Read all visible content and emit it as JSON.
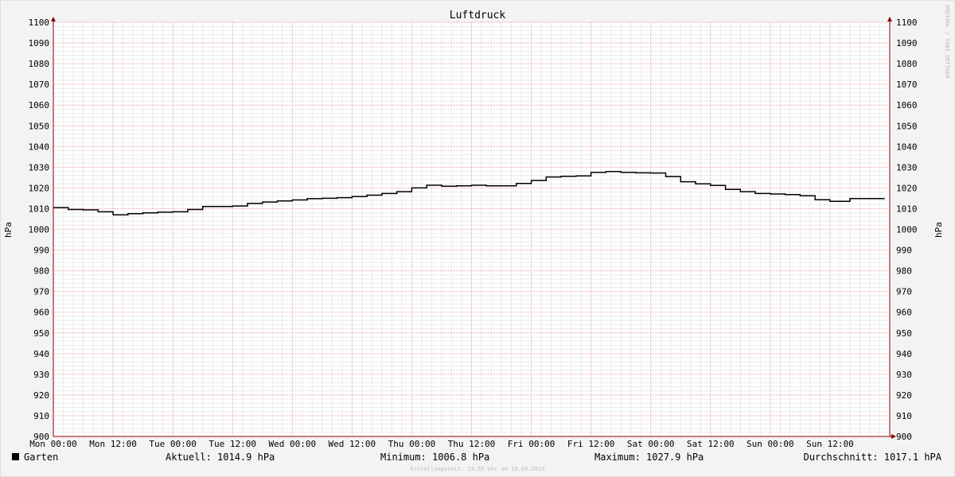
{
  "chart_data": {
    "type": "line",
    "title": "Luftdruck",
    "ylabel": "hPa",
    "ylim": [
      900,
      1100
    ],
    "y_major_step": 10,
    "y_minor_step": 2,
    "xlim": [
      "Mon 00:00",
      "Mon 00:00 (+7d)"
    ],
    "x_tick_labels": [
      "Mon 00:00",
      "Mon 12:00",
      "Tue 00:00",
      "Tue 12:00",
      "Wed 00:00",
      "Wed 12:00",
      "Thu 00:00",
      "Thu 12:00",
      "Fri 00:00",
      "Fri 12:00",
      "Sat 00:00",
      "Sat 12:00",
      "Sun 00:00",
      "Sun 12:00"
    ],
    "x_major_step_hours": 12,
    "x_minor_step_hours": 2,
    "grid": true,
    "line_style": "step",
    "series": [
      {
        "name": "Garten",
        "color": "#000000",
        "x_hours": [
          0,
          3,
          6,
          9,
          12,
          15,
          18,
          21,
          24,
          27,
          30,
          33,
          36,
          39,
          42,
          45,
          48,
          51,
          54,
          57,
          60,
          63,
          66,
          69,
          72,
          75,
          78,
          81,
          84,
          87,
          90,
          93,
          96,
          99,
          102,
          105,
          108,
          111,
          114,
          117,
          120,
          123,
          126,
          129,
          132,
          135,
          138,
          141,
          144,
          147,
          150,
          153,
          156,
          160,
          164,
          167
        ],
        "values": [
          1010.5,
          1009.6,
          1009.4,
          1008.5,
          1007.0,
          1007.6,
          1008.0,
          1008.3,
          1008.5,
          1009.6,
          1011.0,
          1011.0,
          1011.3,
          1012.5,
          1013.2,
          1013.7,
          1014.2,
          1014.8,
          1015.0,
          1015.3,
          1015.8,
          1016.5,
          1017.3,
          1018.2,
          1020.0,
          1021.3,
          1020.8,
          1021.0,
          1021.3,
          1021.0,
          1021.0,
          1022.2,
          1023.6,
          1025.3,
          1025.6,
          1025.8,
          1027.5,
          1027.9,
          1027.5,
          1027.3,
          1027.2,
          1025.5,
          1023.0,
          1022.0,
          1021.2,
          1019.3,
          1018.2,
          1017.3,
          1017.1,
          1016.8,
          1016.2,
          1014.3,
          1013.5,
          1014.9,
          1014.9,
          1014.9
        ]
      }
    ]
  },
  "side_text": "RRDTOOL / TOBI OETIKER",
  "legend": {
    "series_name": "Garten",
    "swatch_color": "#000000",
    "current": "Aktuell: 1014.9 hPa",
    "minimum": "Minimum: 1006.8 hPa",
    "maximum": "Maximum: 1027.9 hPa",
    "average": "Durchschnitt: 1017.1 hPA"
  },
  "footer": "Erstellungszeit: 23:55 Uhr am 15.09.2019",
  "colors": {
    "background": "#f3f3f3",
    "canvas": "#ffffff",
    "major_grid": "#e7a3a3",
    "minor_grid": "#d8d8d8",
    "axis": "#8b0000",
    "text": "#000000",
    "faint_text": "#bbbbbb"
  }
}
